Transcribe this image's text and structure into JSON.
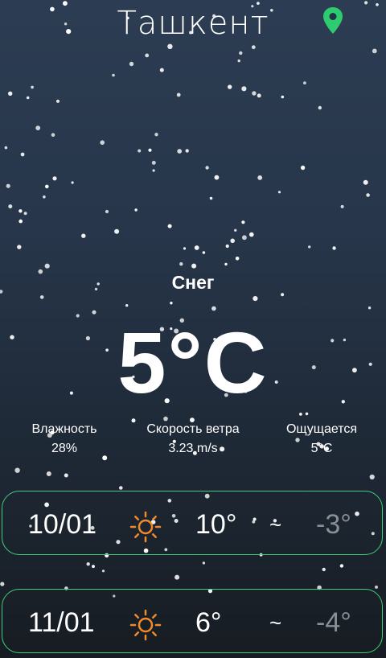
{
  "city": "Ташкент",
  "condition": "Снег",
  "temperature": "5°C",
  "stats": [
    {
      "label": "Влажность",
      "value": "28%"
    },
    {
      "label": "Скорость ветра",
      "value": "3.23 m/s"
    },
    {
      "label": "Ощущается",
      "value": "5°C"
    }
  ],
  "forecast": [
    {
      "date": "10/01",
      "icon": "sun-icon",
      "high": "10°",
      "sep": "~",
      "low": "-3°"
    },
    {
      "date": "11/01",
      "icon": "sun-icon",
      "high": "6°",
      "sep": "~",
      "low": "-4°"
    }
  ],
  "colors": {
    "accent": "#3fcf7a",
    "sun": "#f08a2c",
    "pin": "#2ecc71",
    "low_temp": "#8a8f94"
  }
}
